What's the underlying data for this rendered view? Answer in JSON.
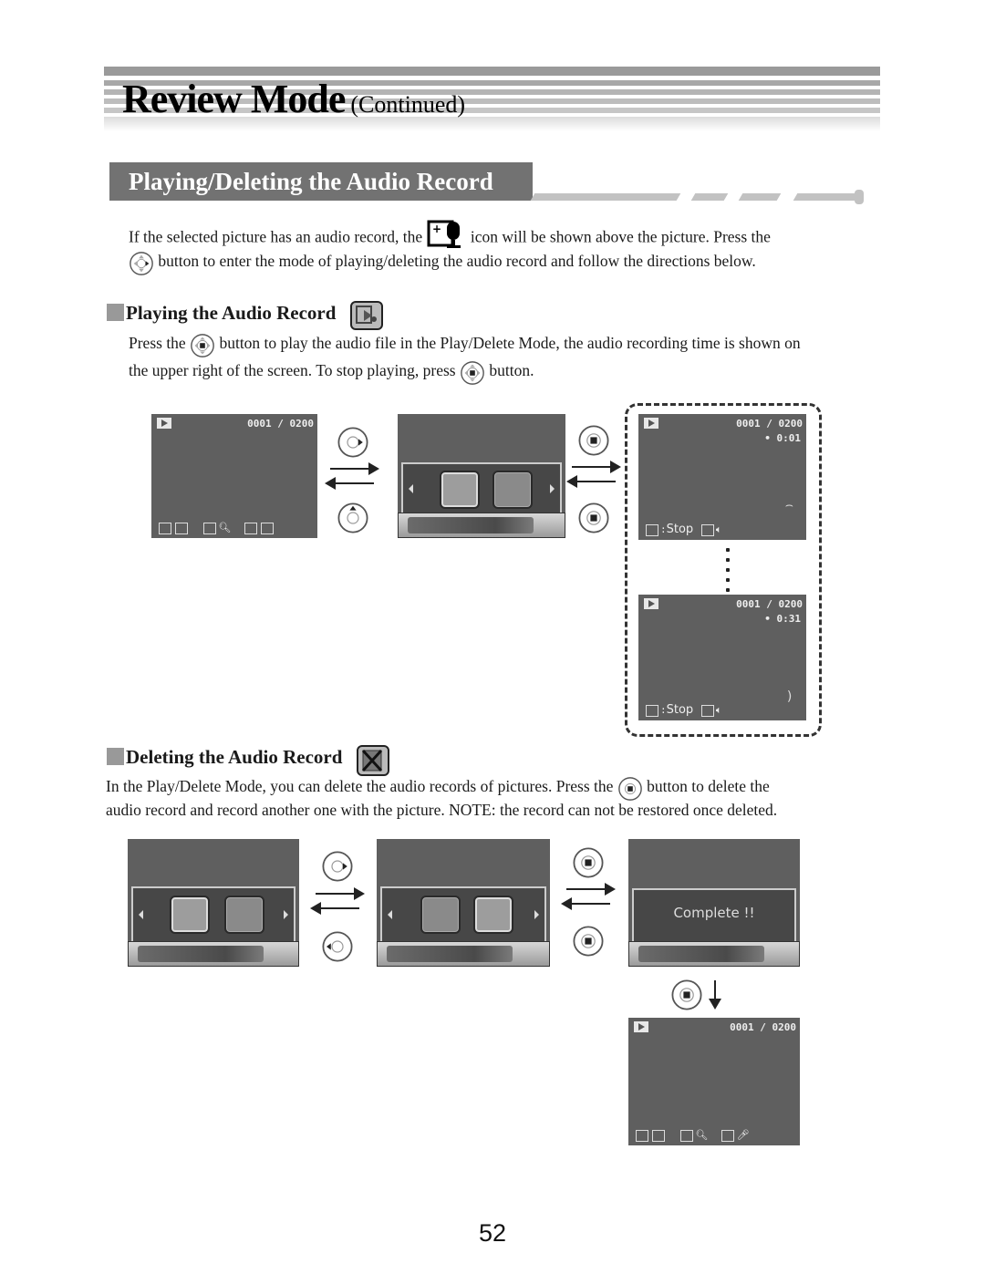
{
  "header": {
    "title": "Review Mode",
    "subtitle": "(Continued)"
  },
  "section": {
    "title": "Playing/Deleting the Audio Record"
  },
  "intro": {
    "line1_a": "If the selected picture has an audio record, the",
    "line1_icon": "voice-memo-icon",
    "line1_b": "icon will be shown above the picture. Press the",
    "line2_icon": "dpad-right-icon",
    "line2_b": "button to enter the mode of playing/deleting the audio record and follow the directions below."
  },
  "playing": {
    "heading": "Playing the Audio Record",
    "heading_icon": "play-audio-icon",
    "line1_a": "Press the",
    "line1_icon": "dpad-ok-icon",
    "line1_b": "button to play the audio file in the Play/Delete Mode, the audio recording time is shown on",
    "line2_a": "the upper right of the screen. To stop playing, press",
    "line2_icon": "dpad-ok-icon",
    "line2_b": "button."
  },
  "deleting": {
    "heading": "Deleting the Audio Record",
    "heading_icon": "delete-audio-icon",
    "line1_a": "In the Play/Delete Mode, you can delete the audio records of pictures. Press the",
    "line1_icon": "dpad-ok-icon",
    "line1_b": "button to delete the",
    "line2": "audio record and record another one with the picture. NOTE: the record can not be restored once deleted."
  },
  "screens": {
    "counter": "0001 / 0200",
    "elapsed_start": "• 0:01",
    "elapsed_end": "• 0:31",
    "stop_label": "Stop",
    "complete_label": "Complete !!"
  },
  "page_number": "52"
}
